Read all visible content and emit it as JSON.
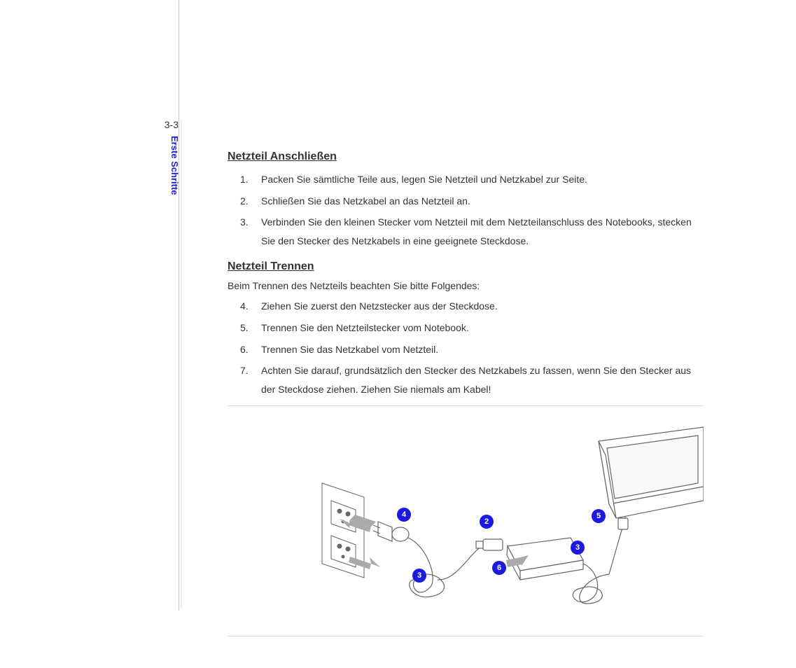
{
  "page": {
    "number": "3-3",
    "side_title": "Erste Schritte"
  },
  "section1": {
    "heading": "Netzteil Anschließen",
    "items": [
      {
        "num": "1.",
        "text": "Packen Sie sämtliche Teile aus, legen Sie Netzteil und Netzkabel zur Seite."
      },
      {
        "num": "2.",
        "text": "Schließen Sie das Netzkabel an das Netzteil an."
      },
      {
        "num": "3.",
        "text": "Verbinden Sie den kleinen Stecker vom Netzteil mit dem Netzteilanschluss des Notebooks, stecken Sie den Stecker des Netzkabels in eine geeignete Steckdose."
      }
    ]
  },
  "section2": {
    "heading": "Netzteil Trennen",
    "intro": "Beim Trennen des Netzteils beachten Sie bitte Folgendes:",
    "items": [
      {
        "num": "4.",
        "text": "Ziehen Sie zuerst den Netzstecker aus der Steckdose."
      },
      {
        "num": "5.",
        "text": "Trennen Sie den Netzteilstecker vom Notebook."
      },
      {
        "num": "6.",
        "text": "Trennen Sie das Netzkabel vom Netzteil."
      },
      {
        "num": "7.",
        "text": "Achten Sie darauf, grundsätzlich den Stecker des Netzkabels zu fassen, wenn Sie den Stecker aus der Steckdose ziehen. Ziehen Sie niemals am Kabel!"
      }
    ]
  },
  "callouts": {
    "c4": "4",
    "c2": "2",
    "c5": "5",
    "c3a": "3",
    "c6": "6",
    "c3b": "3"
  }
}
